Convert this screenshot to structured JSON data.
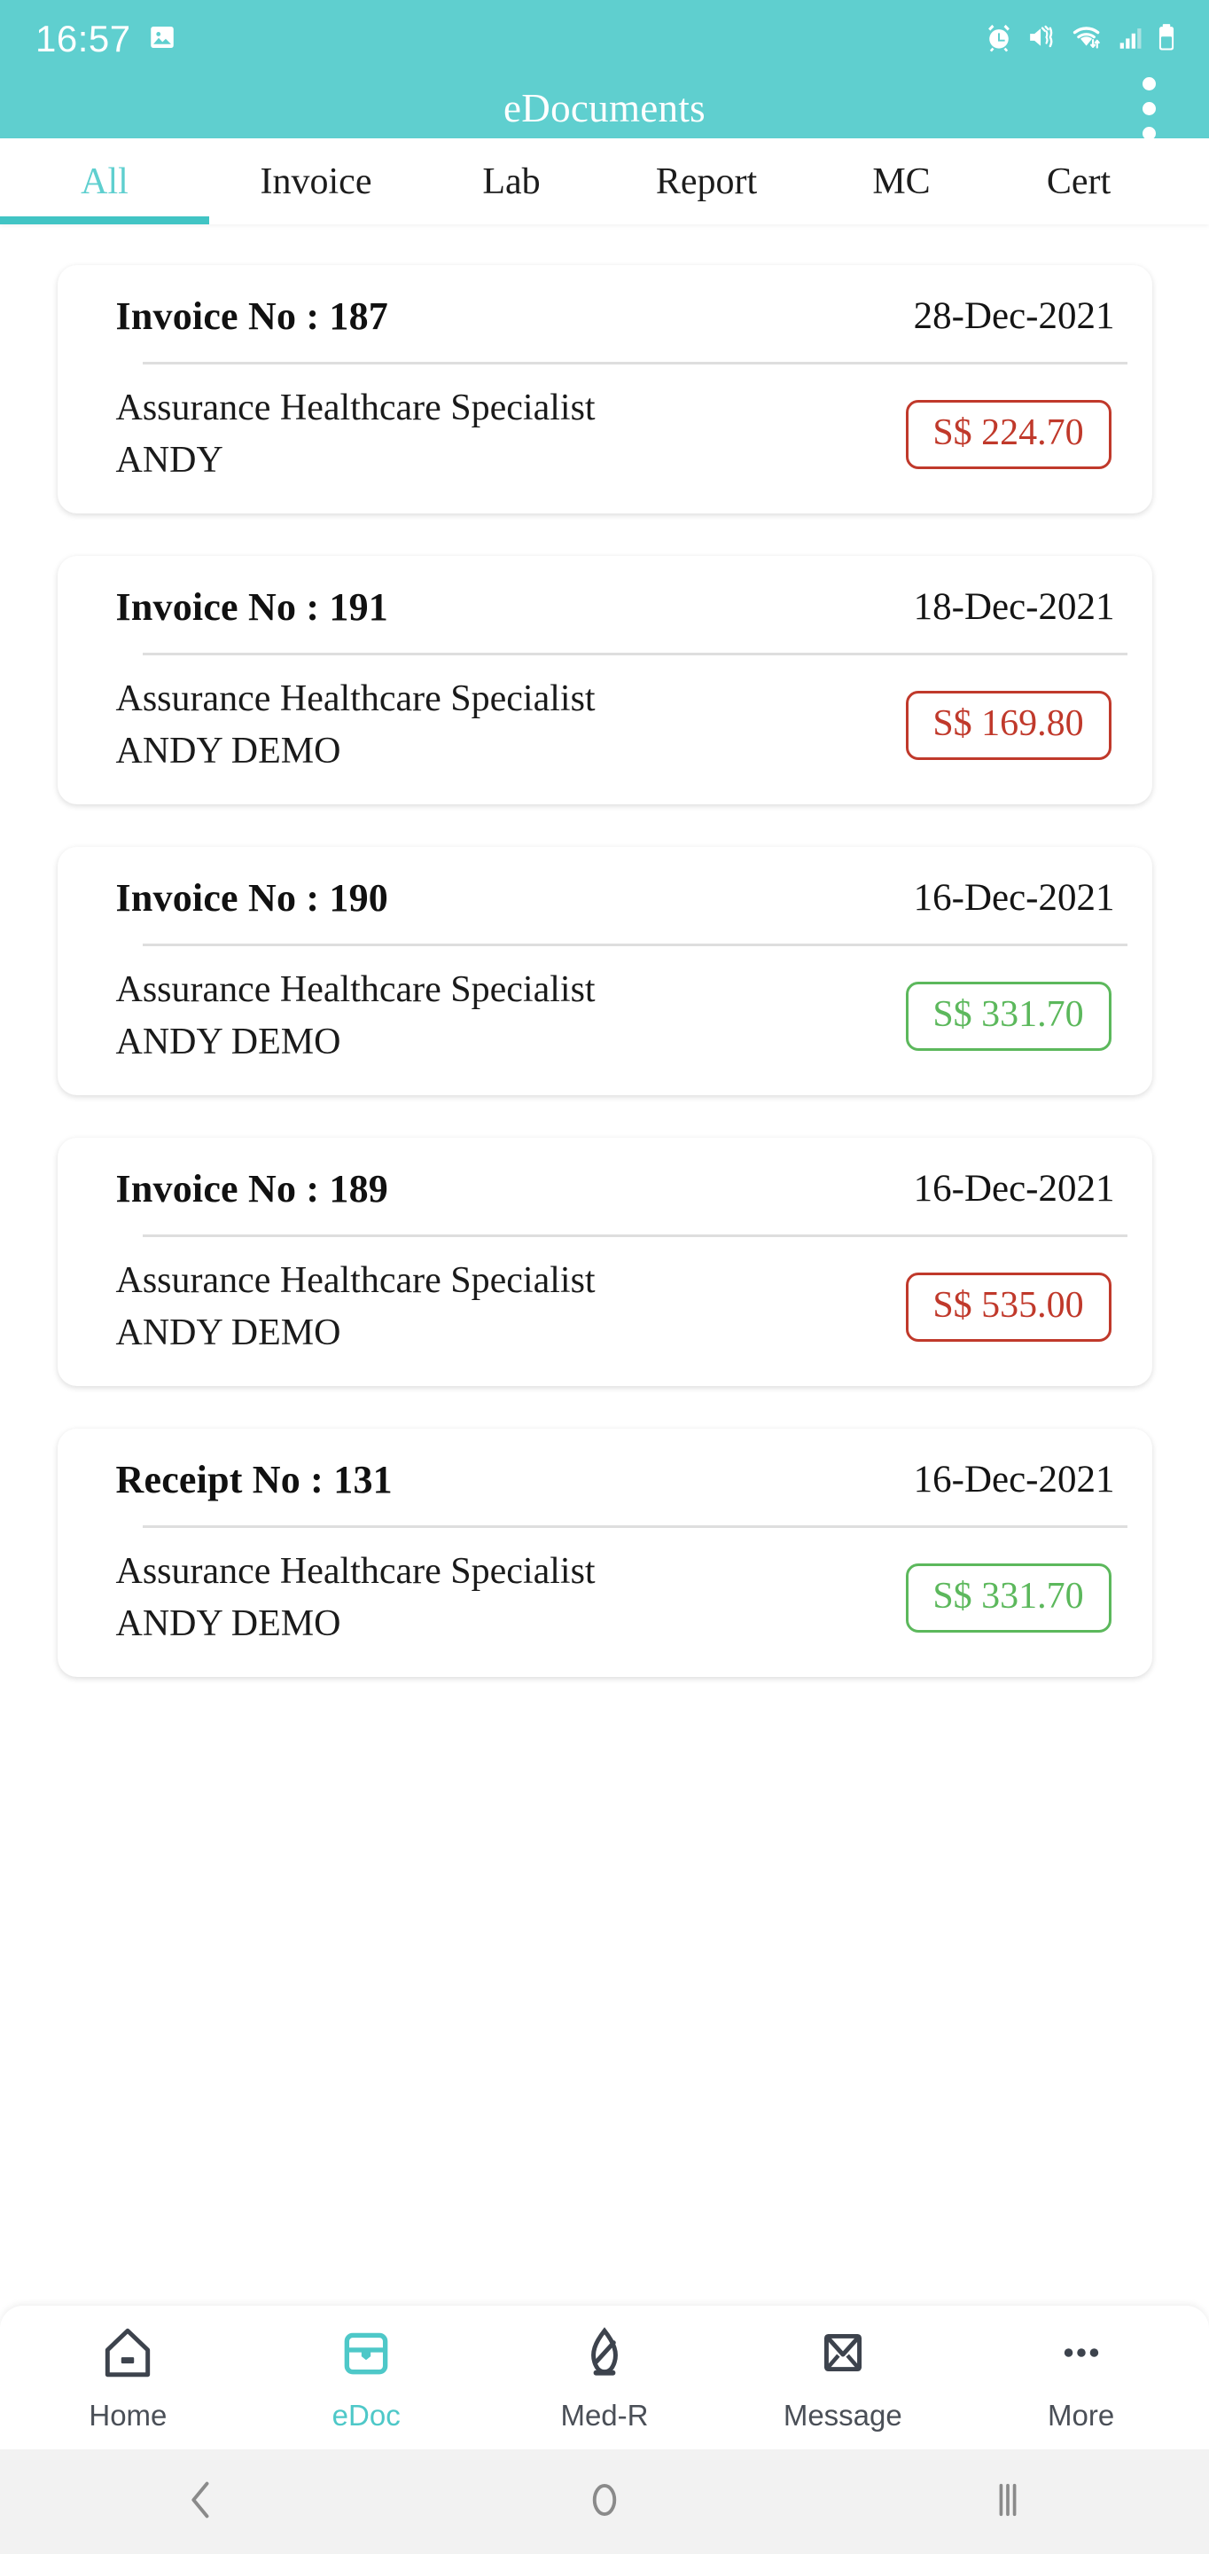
{
  "status_bar": {
    "time": "16:57",
    "left_icons": [
      "image-icon"
    ],
    "right_icons": [
      "alarm-icon",
      "vibrate-mute-icon",
      "wifi-icon",
      "cellular-signal-icon",
      "battery-icon"
    ],
    "background_color": "#5fcfcf"
  },
  "app_bar": {
    "title": "eDocuments",
    "overflow_menu_icon": "more-vertical-icon",
    "background_color": "#5fcfcf"
  },
  "tabs": {
    "active_index": 0,
    "accent_color": "#41c4c4",
    "items": [
      {
        "label": "All"
      },
      {
        "label": "Invoice"
      },
      {
        "label": "Lab"
      },
      {
        "label": "Report"
      },
      {
        "label": "MC"
      },
      {
        "label": "Cert"
      }
    ]
  },
  "documents": [
    {
      "doc_no": "Invoice No : 187",
      "date": "28-Dec-2021",
      "clinic": "Assurance Healthcare Specialist",
      "patient": "ANDY",
      "amount": "S$ 224.70",
      "amount_state": "unpaid"
    },
    {
      "doc_no": "Invoice No : 191",
      "date": "18-Dec-2021",
      "clinic": "Assurance Healthcare Specialist",
      "patient": "ANDY DEMO",
      "amount": "S$ 169.80",
      "amount_state": "unpaid"
    },
    {
      "doc_no": "Invoice No : 190",
      "date": "16-Dec-2021",
      "clinic": "Assurance Healthcare Specialist",
      "patient": "ANDY DEMO",
      "amount": "S$ 331.70",
      "amount_state": "paid"
    },
    {
      "doc_no": "Invoice No : 189",
      "date": "16-Dec-2021",
      "clinic": "Assurance Healthcare Specialist",
      "patient": "ANDY DEMO",
      "amount": "S$ 535.00",
      "amount_state": "unpaid"
    },
    {
      "doc_no": "Receipt No : 131",
      "date": "16-Dec-2021",
      "clinic": "Assurance Healthcare Specialist",
      "patient": "ANDY DEMO",
      "amount": "S$ 331.70",
      "amount_state": "paid"
    }
  ],
  "colors": {
    "brand_teal": "#5fcfcf",
    "accent_teal": "#41c4c4",
    "amount_unpaid": "#c0392b",
    "amount_paid": "#5cb85c",
    "text_primary": "#111111",
    "nav_inactive": "#4a4f57"
  },
  "bottom_nav": {
    "active_index": 1,
    "items": [
      {
        "label": "Home",
        "icon": "home-icon"
      },
      {
        "label": "eDoc",
        "icon": "document-card-icon"
      },
      {
        "label": "Med-R",
        "icon": "medical-record-icon"
      },
      {
        "label": "Message",
        "icon": "envelope-icon"
      },
      {
        "label": "More",
        "icon": "more-horizontal-icon"
      }
    ]
  },
  "android_nav": {
    "buttons": [
      {
        "name": "back",
        "icon": "chevron-left-icon"
      },
      {
        "name": "home",
        "icon": "circle-icon"
      },
      {
        "name": "recents",
        "icon": "vertical-bars-icon"
      }
    ]
  }
}
